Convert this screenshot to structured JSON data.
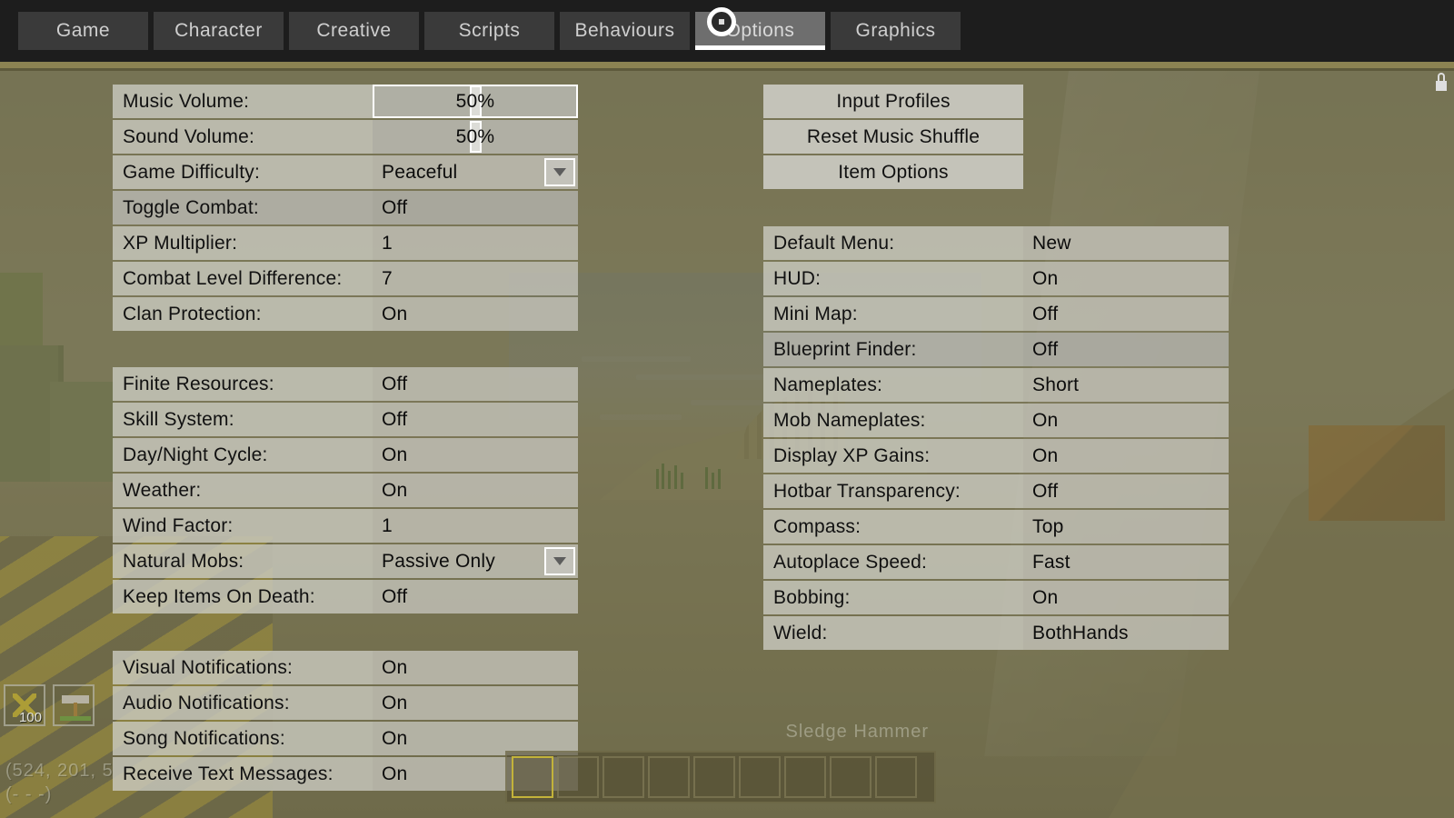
{
  "tabs": [
    {
      "label": "Game",
      "active": false
    },
    {
      "label": "Character",
      "active": false
    },
    {
      "label": "Creative",
      "active": false
    },
    {
      "label": "Scripts",
      "active": false
    },
    {
      "label": "Behaviours",
      "active": false
    },
    {
      "label": "Options",
      "active": true
    },
    {
      "label": "Graphics",
      "active": false
    }
  ],
  "left": {
    "group1": [
      {
        "label": "Music Volume:",
        "value": "50%",
        "type": "slider",
        "percent": 50,
        "focused": true
      },
      {
        "label": "Sound Volume:",
        "value": "50%",
        "type": "slider",
        "percent": 50,
        "focused": false
      },
      {
        "label": "Game Difficulty:",
        "value": "Peaceful",
        "type": "dropdown"
      },
      {
        "label": "Toggle Combat:",
        "value": "Off",
        "type": "toggle",
        "dim": true
      },
      {
        "label": "XP Multiplier:",
        "value": "1",
        "type": "number"
      },
      {
        "label": "Combat Level Difference:",
        "value": "7",
        "type": "number"
      },
      {
        "label": "Clan Protection:",
        "value": "On",
        "type": "toggle"
      }
    ],
    "group2": [
      {
        "label": "Finite Resources:",
        "value": "Off",
        "type": "toggle"
      },
      {
        "label": "Skill System:",
        "value": "Off",
        "type": "toggle"
      },
      {
        "label": "Day/Night Cycle:",
        "value": "On",
        "type": "toggle"
      },
      {
        "label": "Weather:",
        "value": "On",
        "type": "toggle"
      },
      {
        "label": "Wind Factor:",
        "value": "1",
        "type": "number"
      },
      {
        "label": "Natural Mobs:",
        "value": "Passive Only",
        "type": "dropdown"
      },
      {
        "label": "Keep Items On Death:",
        "value": "Off",
        "type": "toggle"
      }
    ],
    "group3": [
      {
        "label": "Visual Notifications:",
        "value": "On",
        "type": "toggle"
      },
      {
        "label": "Audio Notifications:",
        "value": "On",
        "type": "toggle"
      },
      {
        "label": "Song Notifications:",
        "value": "On",
        "type": "toggle"
      },
      {
        "label": "Receive Text Messages:",
        "value": "On",
        "type": "toggle"
      }
    ]
  },
  "right": {
    "buttons": [
      {
        "label": "Input Profiles"
      },
      {
        "label": "Reset Music Shuffle"
      },
      {
        "label": "Item Options"
      }
    ],
    "settings": [
      {
        "label": "Default Menu:",
        "value": "New",
        "type": "choice"
      },
      {
        "label": "HUD:",
        "value": "On",
        "type": "toggle"
      },
      {
        "label": "Mini Map:",
        "value": "Off",
        "type": "toggle"
      },
      {
        "label": "Blueprint Finder:",
        "value": "Off",
        "type": "toggle",
        "dim": true
      },
      {
        "label": "Nameplates:",
        "value": "Short",
        "type": "choice"
      },
      {
        "label": "Mob Nameplates:",
        "value": "On",
        "type": "toggle"
      },
      {
        "label": "Display XP Gains:",
        "value": "On",
        "type": "toggle"
      },
      {
        "label": "Hotbar Transparency:",
        "value": "Off",
        "type": "toggle"
      },
      {
        "label": "Compass:",
        "value": "Top",
        "type": "choice"
      },
      {
        "label": "Autoplace Speed:",
        "value": "Fast",
        "type": "choice"
      },
      {
        "label": "Bobbing:",
        "value": "On",
        "type": "toggle"
      },
      {
        "label": "Wield:",
        "value": "BothHands",
        "type": "choice"
      }
    ]
  },
  "hud": {
    "coords_primary": "(524, 201, 5",
    "coords_secondary": "(- - -)",
    "inventory_slots": [
      {
        "icon": "crossed-block-icon",
        "count": "100"
      },
      {
        "icon": "sledge-hammer-icon",
        "count": ""
      }
    ],
    "held_item_name": "Sledge Hammer",
    "hotbar_slot_count": 9,
    "hotbar_selected_index": 0,
    "lock_icon": "lock-icon"
  },
  "colors": {
    "tabbar_bg": "#1d1d1d",
    "tab_bg": "#3a3a3a",
    "tab_active_bg": "#6e6e6e",
    "accent_underline": "#8c8352",
    "panel_row_label": "#cbcac1",
    "panel_row_value": "#c4c3ba",
    "world_tint": "#6e6a48"
  }
}
